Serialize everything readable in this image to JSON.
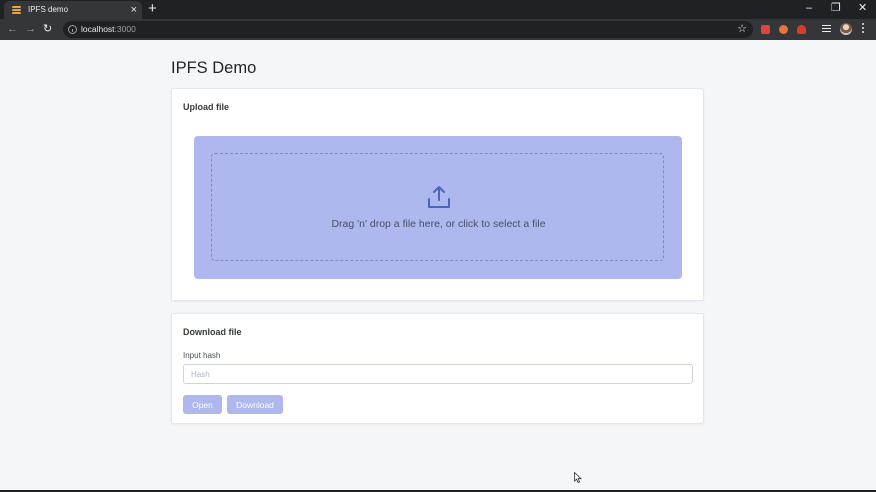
{
  "browser": {
    "tab_title": "IPFS demo",
    "tab_close": "×",
    "new_tab": "+",
    "url_host": "localhost",
    "url_port": ":3000",
    "controls": {
      "minimize": "–",
      "restore": "❐",
      "close": "✕"
    },
    "nav": {
      "back": "←",
      "forward": "→",
      "reload": "↻"
    },
    "star": "☆"
  },
  "page": {
    "title": "IPFS Demo",
    "upload": {
      "title": "Upload file",
      "dropzone_text": "Drag 'n' drop a file here, or click to select a file",
      "icon": "upload-icon"
    },
    "download": {
      "title": "Download file",
      "input_label": "Input hash",
      "input_placeholder": "Hash",
      "input_value": "",
      "open_label": "Open",
      "download_label": "Download"
    }
  },
  "colors": {
    "accent": "#aeb7ee",
    "background": "#f5f6f8",
    "chrome_dark": "#202124",
    "chrome_toolbar": "#35363a"
  }
}
